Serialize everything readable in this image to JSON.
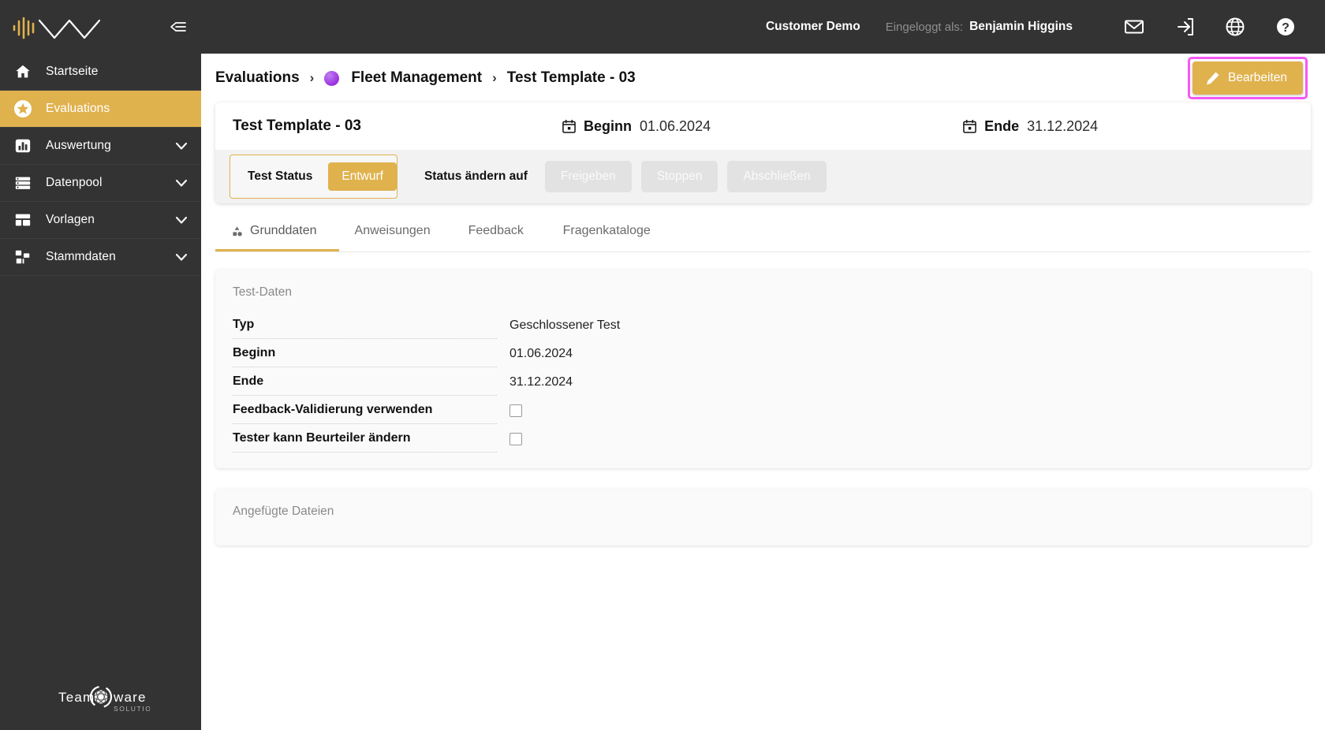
{
  "brand": {
    "logo_icon": "soundwave-chevron-logo",
    "collapse_icon": "collapse-sidebar-icon",
    "footer_logo_line1": "Team",
    "footer_logo_line2": "ware",
    "footer_logo_sub": "SOLUTIONS"
  },
  "sidebar": {
    "items": [
      {
        "label": "Startseite",
        "icon": "home-icon",
        "active": false,
        "chevron": false
      },
      {
        "label": "Evaluations",
        "icon": "star-icon",
        "active": true,
        "chevron": false
      },
      {
        "label": "Auswertung",
        "icon": "bar-chart-icon",
        "active": false,
        "chevron": true
      },
      {
        "label": "Datenpool",
        "icon": "list-icon",
        "active": false,
        "chevron": true
      },
      {
        "label": "Vorlagen",
        "icon": "layout-icon",
        "active": false,
        "chevron": true
      },
      {
        "label": "Stammdaten",
        "icon": "sitemap-icon",
        "active": false,
        "chevron": true
      }
    ]
  },
  "topbar": {
    "customer": "Customer Demo",
    "logged_in_label": "Eingeloggt als:",
    "user": "Benjamin Higgins",
    "icons": [
      "mail-icon",
      "logout-icon",
      "globe-icon",
      "help-icon"
    ]
  },
  "breadcrumb": {
    "root": "Evaluations",
    "separator": "›",
    "project": "Fleet Management",
    "project_dot_color": "#9b30e0",
    "current": "Test Template - 03"
  },
  "actions": {
    "edit_label": "Bearbeiten",
    "edit_icon": "pencil-icon",
    "edit_highlight_color": "#f559f5",
    "edit_bg_color": "#e0b24e"
  },
  "info": {
    "title": "Test Template - 03",
    "begin_label": "Beginn",
    "begin_value": "01.06.2024",
    "end_label": "Ende",
    "end_value": "31.12.2024",
    "calendar_icon": "calendar-icon"
  },
  "status": {
    "test_status_label": "Test Status",
    "current_status": "Entwurf",
    "change_label": "Status ändern auf",
    "buttons": [
      "Freigeben",
      "Stoppen",
      "Abschließen"
    ]
  },
  "tabs": [
    {
      "label": "Grunddaten",
      "icon": "shapes-icon",
      "active": true
    },
    {
      "label": "Anweisungen",
      "icon": "",
      "active": false
    },
    {
      "label": "Feedback",
      "icon": "",
      "active": false
    },
    {
      "label": "Fragenkataloge",
      "icon": "",
      "active": false
    }
  ],
  "test_data": {
    "title": "Test-Daten",
    "rows": [
      {
        "label": "Typ",
        "value": "Geschlossener Test",
        "type": "text"
      },
      {
        "label": "Beginn",
        "value": "01.06.2024",
        "type": "text"
      },
      {
        "label": "Ende",
        "value": "31.12.2024",
        "type": "text"
      },
      {
        "label": "Feedback-Validierung verwenden",
        "value": "",
        "type": "checkbox",
        "checked": false
      },
      {
        "label": "Tester kann Beurteiler ändern",
        "value": "",
        "type": "checkbox",
        "checked": false
      }
    ]
  },
  "files": {
    "title": "Angefügte Dateien"
  },
  "colors": {
    "accent": "#e0b24e",
    "sidebar_bg": "#333333",
    "panel_bg": "#fafafa",
    "highlight": "#f559f5"
  }
}
